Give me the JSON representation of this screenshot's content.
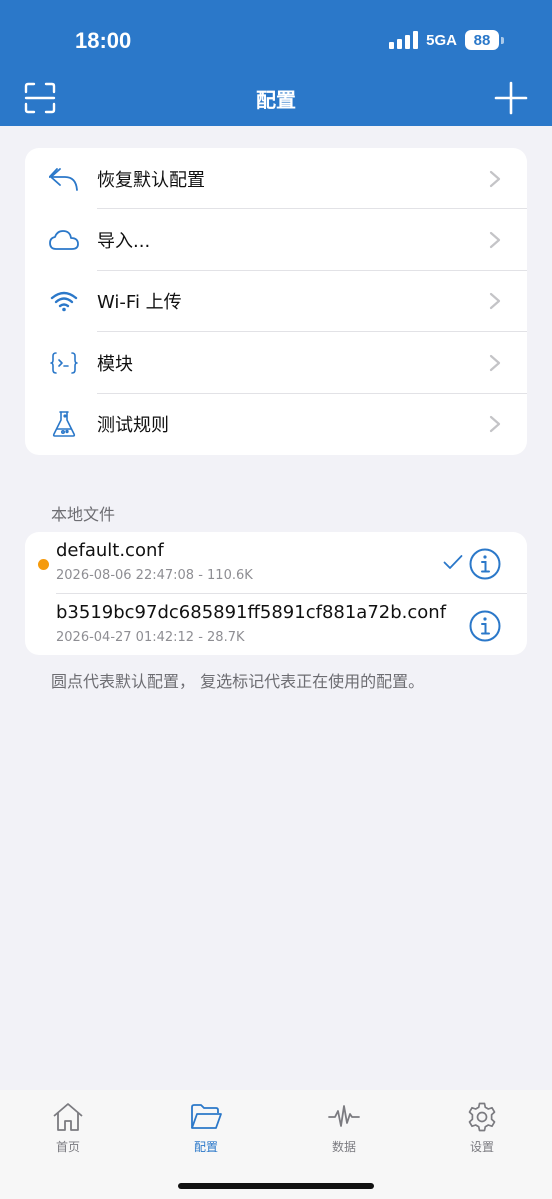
{
  "status": {
    "time": "18:00",
    "network": "5GA",
    "battery": "88"
  },
  "nav": {
    "title": "配置"
  },
  "menu": [
    {
      "label": "恢复默认配置",
      "icon": "undo-arrow-icon"
    },
    {
      "label": "导入...",
      "icon": "cloud-icon"
    },
    {
      "label": "Wi-Fi 上传",
      "icon": "wifi-icon"
    },
    {
      "label": "模块",
      "icon": "code-braces-icon"
    },
    {
      "label": "测试规则",
      "icon": "flask-icon"
    }
  ],
  "files": {
    "header": "本地文件",
    "items": [
      {
        "name": "default.conf",
        "meta": "2026-08-06 22:47:08 - 110.6K",
        "is_default": true,
        "in_use": true
      },
      {
        "name": "b3519bc97dc685891ff5891cf881a72b.conf",
        "meta": "2026-04-27 01:42:12 - 28.7K",
        "is_default": false,
        "in_use": false
      }
    ],
    "footnote": "圆点代表默认配置， 复选标记代表正在使用的配置。"
  },
  "tabs": [
    {
      "label": "首页",
      "icon": "home-icon",
      "active": false
    },
    {
      "label": "配置",
      "icon": "folder-icon",
      "active": true
    },
    {
      "label": "数据",
      "icon": "waveform-icon",
      "active": false
    },
    {
      "label": "设置",
      "icon": "gear-icon",
      "active": false
    }
  ],
  "colors": {
    "accent": "#2b78c9",
    "default_dot": "#f59a0c"
  }
}
